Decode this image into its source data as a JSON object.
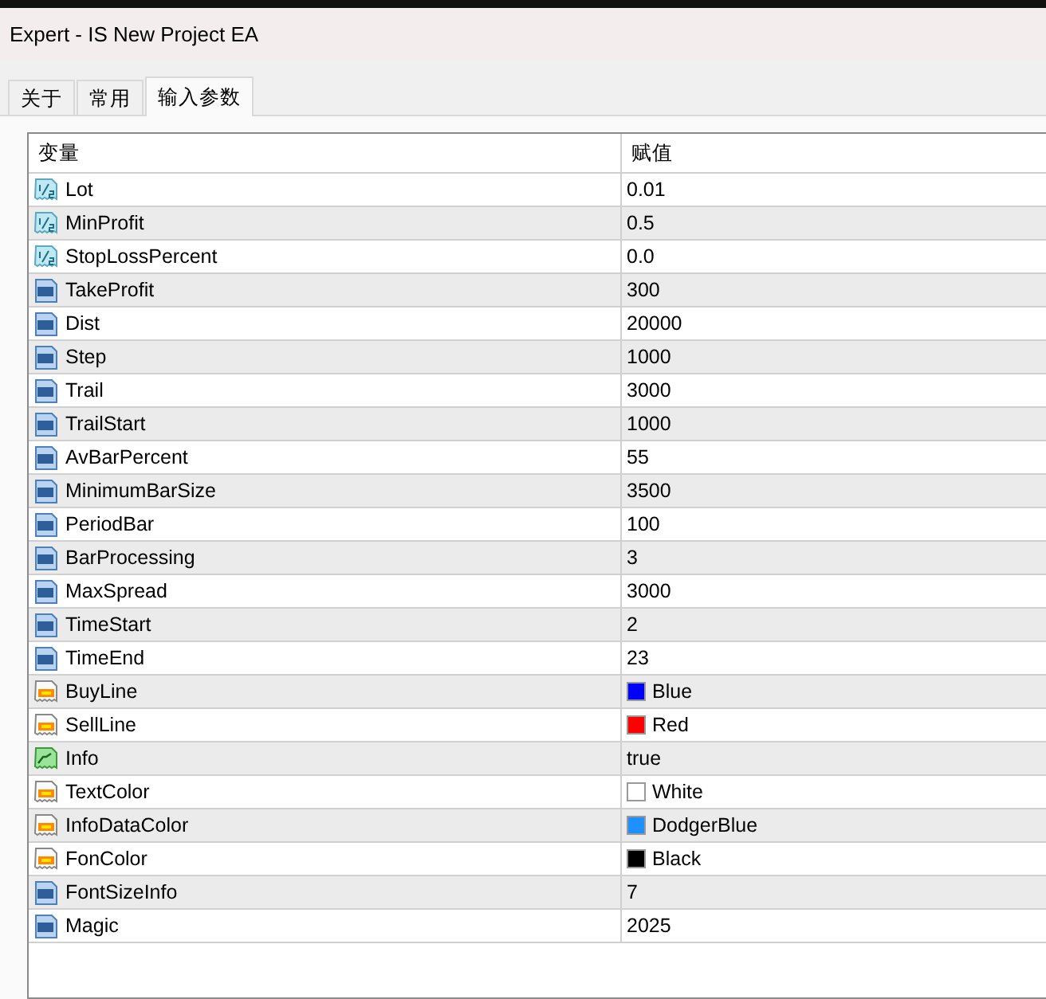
{
  "window": {
    "title": "Expert - IS New Project EA"
  },
  "tabs": [
    {
      "label": "关于",
      "selected": false
    },
    {
      "label": "常用",
      "selected": false
    },
    {
      "label": "输入参数",
      "selected": true
    }
  ],
  "table": {
    "columns": [
      "变量",
      "赋值"
    ],
    "rows": [
      {
        "kind": "double",
        "name": "Lot",
        "value": "0.01"
      },
      {
        "kind": "double",
        "name": "MinProfit",
        "value": "0.5"
      },
      {
        "kind": "double",
        "name": "StopLossPercent",
        "value": "0.0"
      },
      {
        "kind": "int",
        "name": "TakeProfit",
        "value": "300"
      },
      {
        "kind": "int",
        "name": "Dist",
        "value": "20000"
      },
      {
        "kind": "int",
        "name": "Step",
        "value": "1000"
      },
      {
        "kind": "int",
        "name": "Trail",
        "value": "3000"
      },
      {
        "kind": "int",
        "name": "TrailStart",
        "value": "1000"
      },
      {
        "kind": "int",
        "name": "AvBarPercent",
        "value": "55"
      },
      {
        "kind": "int",
        "name": "MinimumBarSize",
        "value": "3500"
      },
      {
        "kind": "int",
        "name": "PeriodBar",
        "value": "100"
      },
      {
        "kind": "int",
        "name": "BarProcessing",
        "value": "3"
      },
      {
        "kind": "int",
        "name": "MaxSpread",
        "value": "3000"
      },
      {
        "kind": "int",
        "name": "TimeStart",
        "value": "2"
      },
      {
        "kind": "int",
        "name": "TimeEnd",
        "value": "23"
      },
      {
        "kind": "color",
        "name": "BuyLine",
        "value": "Blue",
        "color": "#0000ff"
      },
      {
        "kind": "color",
        "name": "SellLine",
        "value": "Red",
        "color": "#ff0000"
      },
      {
        "kind": "bool",
        "name": "Info",
        "value": "true"
      },
      {
        "kind": "color",
        "name": "TextColor",
        "value": "White",
        "color": "#ffffff"
      },
      {
        "kind": "color",
        "name": "InfoDataColor",
        "value": "DodgerBlue",
        "color": "#1e90ff"
      },
      {
        "kind": "color",
        "name": "FonColor",
        "value": "Black",
        "color": "#000000"
      },
      {
        "kind": "int",
        "name": "FontSizeInfo",
        "value": "7"
      },
      {
        "kind": "int",
        "name": "Magic",
        "value": "2025"
      }
    ]
  }
}
